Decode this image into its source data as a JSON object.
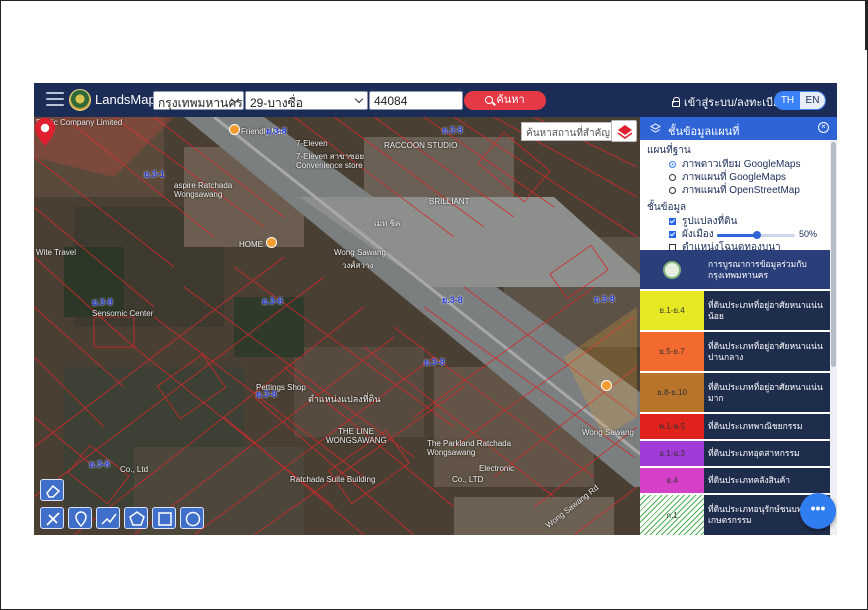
{
  "header": {
    "brand": "LandsMaps",
    "province": "กรุงเทพมหานคร",
    "district": "29-บางซื่อ",
    "parcel_no": "44084",
    "search_label": "ค้นหา",
    "login_label": "เข้าสู่ระบบ/ลงทะเบียน",
    "lang_th": "TH",
    "lang_en": "EN"
  },
  "map": {
    "place_search_placeholder": "ค้นหาสถานที่สำคัญ",
    "labels": {
      "company": "Public Company Limited",
      "friendly": "Friendly bus",
      "seven_eleven": "7-Eleven",
      "seven_eleven_th": "7-Eleven สาขาซอย",
      "convenience": "Convenience store",
      "raccoon": "RACCOON STUDIO",
      "brilliant": "BRILLIANT",
      "aspire": "aspire Ratchada Wongsawang",
      "home": "HOME",
      "meth": "เมท ชิค",
      "wong_sawang": "Wong Sawang",
      "wongsawang_th": "วงศ์สว่าง",
      "wite": "Wite Travel",
      "sensomic": "Sensomic Center",
      "pettings": "Pettings Shop",
      "parcel_pos": "ตำแหน่งแปลงที่ดิน",
      "theline": "THE LINE WONGSAWANG",
      "parkland": "The Parkland Ratchada Wongsawang",
      "suite": "Ratchada Suite Building",
      "electronic": "Electronic",
      "ltd1": "Co., Ltd",
      "ltd2": "Co., LTD",
      "road": "Wong Sawang Rd",
      "sukhumvit": "Wong Sawang"
    },
    "zone_labels": [
      "ย.3-1",
      "ย.3-8",
      "ย.3-8",
      "ย.3-8",
      "ย.3-8",
      "ย.3-8",
      "ย.3-8",
      "ย.3-8",
      "ย.3-8",
      "ย.3-8"
    ]
  },
  "panel": {
    "title": "ชั้นข้อมูลแผนที่",
    "base_section": "แผนที่ฐาน",
    "base_options": [
      "ภาพดาวเทียม GoogleMaps",
      "ภาพแผนที่ GoogleMaps",
      "ภาพแผนที่ OpenStreetMap"
    ],
    "data_section": "ชั้นข้อมูล",
    "data_options": [
      "รูปแปลงที่ดิน",
      "ผังเมือง",
      "ตำแหน่งโฉนดทองบนา"
    ],
    "opacity_label": "50%",
    "legend_header": "การบูรณาการข้อมูลร่วมกับ กรุงเทพมหานคร",
    "legend": [
      {
        "code": "ย.1-ย.4",
        "text": "ที่ดินประเภทที่อยู่อาศัยหนาแน่นน้อย",
        "color": "#e5e823"
      },
      {
        "code": "ย.5-ย.7",
        "text": "ที่ดินประเภทที่อยู่อาศัยหนาแน่นปานกลาง",
        "color": "#f26a2e"
      },
      {
        "code": "ย.8-ย.10",
        "text": "ที่ดินประเภทที่อยู่อาศัยหนาแน่นมาก",
        "color": "#b8742b"
      },
      {
        "code": "พ.1-พ.5",
        "text": "ที่ดินประเภทพาณิชยกรรม",
        "color": "#e0221c"
      },
      {
        "code": "อ.1-อ.3",
        "text": "ที่ดินประเภทอุตสาหกรรม",
        "color": "#a13ad6"
      },
      {
        "code": "อ.4",
        "text": "ที่ดินประเภทคลังสินค้า",
        "color": "#d640c9"
      },
      {
        "code": "ก.1",
        "text": "ที่ดินประเภทอนุรักษ์ชนบทและเกษตรกรรม",
        "color": "#ffffff"
      }
    ]
  },
  "fab_label": "•••"
}
